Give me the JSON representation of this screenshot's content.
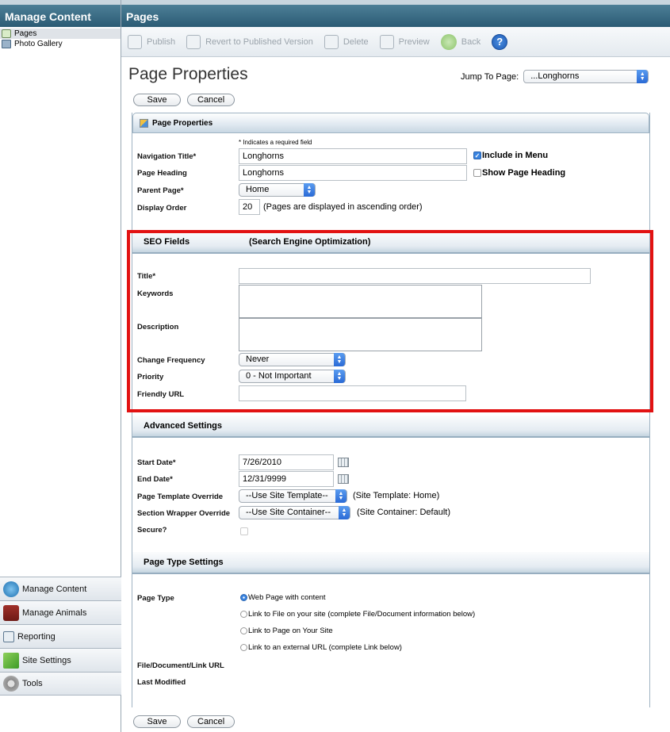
{
  "sidebar": {
    "header": "Manage Content",
    "tree": [
      {
        "label": "Pages",
        "icon": "page-icon"
      },
      {
        "label": "Photo Gallery",
        "icon": "gallery-icon"
      }
    ],
    "nav": [
      {
        "label": "Manage Content",
        "icon": "globe-icon"
      },
      {
        "label": "Manage Animals",
        "icon": "barn-icon"
      },
      {
        "label": "Reporting",
        "icon": "chart-icon"
      },
      {
        "label": "Site Settings",
        "icon": "blocks-icon"
      },
      {
        "label": "Tools",
        "icon": "gear-icon"
      }
    ]
  },
  "main": {
    "header": "Pages",
    "toolbar": {
      "publish": "Publish",
      "revert": "Revert to Published Version",
      "delete": "Delete",
      "preview": "Preview",
      "back": "Back",
      "help": "?"
    },
    "title": "Page Properties",
    "jump_label": "Jump To Page:",
    "jump_value": "...Longhorns",
    "save": "Save",
    "cancel": "Cancel"
  },
  "props": {
    "panel_title": "Page Properties",
    "required_note": "* Indicates a required field",
    "nav_title_label": "Navigation Title*",
    "nav_title_value": "Longhorns",
    "include_menu": "Include in Menu",
    "page_heading_label": "Page Heading",
    "page_heading_value": "Longhorns",
    "show_heading": "Show Page Heading",
    "parent_label": "Parent Page*",
    "parent_value": "Home",
    "order_label": "Display Order",
    "order_value": "20",
    "order_note": "(Pages are displayed in ascending order)"
  },
  "seo": {
    "title": "SEO Fields",
    "subtitle": "(Search Engine Optimization)",
    "title_label": "Title*",
    "keywords_label": "Keywords",
    "description_label": "Description",
    "frequency_label": "Change Frequency",
    "frequency_value": "Never",
    "priority_label": "Priority",
    "priority_value": "0 - Not Important",
    "friendly_label": "Friendly URL"
  },
  "advanced": {
    "title": "Advanced Settings",
    "start_label": "Start Date*",
    "start_value": "7/26/2010",
    "end_label": "End Date*",
    "end_value": "12/31/9999",
    "template_label": "Page Template Override",
    "template_value": "--Use Site Template--",
    "template_note": "(Site Template: Home)",
    "wrapper_label": "Section Wrapper Override",
    "wrapper_value": "--Use Site Container--",
    "wrapper_note": "(Site Container: Default)",
    "secure_label": "Secure?"
  },
  "pagetype": {
    "title": "Page Type Settings",
    "type_label": "Page Type",
    "options": [
      "Web Page with content",
      "Link to File on your site (complete File/Document information below)",
      "Link to Page on Your Site",
      "Link to an external URL (complete Link below)"
    ],
    "file_label": "File/Document/Link URL",
    "modified_label": "Last Modified"
  }
}
